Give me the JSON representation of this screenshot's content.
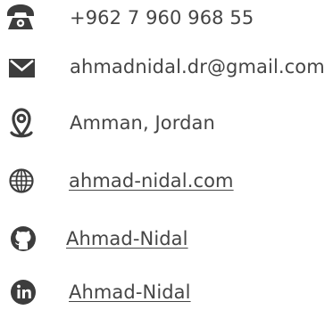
{
  "contact": {
    "items": [
      {
        "icon": "phone-icon",
        "text": "+962 7 960 968 55",
        "link": false
      },
      {
        "icon": "envelope-icon",
        "text": "ahmadnidal.dr@gmail.com",
        "link": false
      },
      {
        "icon": "location-pin-icon",
        "text": "Amman, Jordan",
        "link": false
      },
      {
        "icon": "globe-icon",
        "text": "ahmad-nidal.com",
        "link": true
      },
      {
        "icon": "github-icon",
        "text": "Ahmad-Nidal",
        "link": true
      },
      {
        "icon": "linkedin-icon",
        "text": "Ahmad-Nidal",
        "link": true
      }
    ]
  },
  "colors": {
    "icon": "#3d3d3d",
    "text": "#454545"
  }
}
